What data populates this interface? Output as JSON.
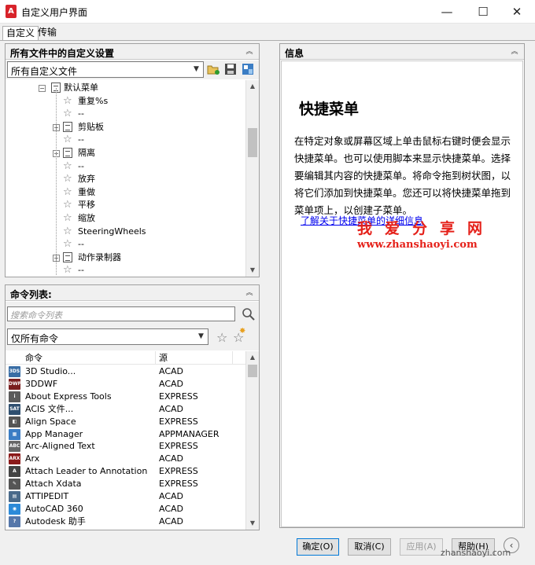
{
  "window": {
    "title": "自定义用户界面",
    "app_icon": "A",
    "minimize": "—",
    "maximize": "☐",
    "close": "✕"
  },
  "tabs": [
    "自定义",
    "传输"
  ],
  "custom_settings": {
    "header": "所有文件中的自定义设置",
    "combo_value": "所有自定义文件",
    "tree": [
      {
        "label": "默认菜单",
        "icon": "menu",
        "level": 0,
        "expander": "−"
      },
      {
        "label": "重复%s",
        "icon": "star",
        "level": 1
      },
      {
        "label": "--",
        "icon": "star",
        "level": 1
      },
      {
        "label": "剪贴板",
        "icon": "doc",
        "level": 1,
        "expander": "+"
      },
      {
        "label": "--",
        "icon": "star",
        "level": 1
      },
      {
        "label": "隔离",
        "icon": "doc",
        "level": 1,
        "expander": "+"
      },
      {
        "label": "--",
        "icon": "star",
        "level": 1
      },
      {
        "label": "放弃",
        "icon": "star",
        "level": 1
      },
      {
        "label": "重做",
        "icon": "star",
        "level": 1
      },
      {
        "label": "平移",
        "icon": "star",
        "level": 1
      },
      {
        "label": "缩放",
        "icon": "star",
        "level": 1
      },
      {
        "label": "SteeringWheels",
        "icon": "star",
        "level": 1
      },
      {
        "label": "--",
        "icon": "star",
        "level": 1
      },
      {
        "label": "动作录制器",
        "icon": "doc",
        "level": 1,
        "expander": "+"
      },
      {
        "label": "--",
        "icon": "star",
        "level": 1
      }
    ]
  },
  "command_list": {
    "header": "命令列表:",
    "search_placeholder": "搜索命令列表",
    "filter_value": "仅所有命令",
    "col_command": "命令",
    "col_source": "源",
    "rows": [
      {
        "name": "3D Studio...",
        "source": "ACAD",
        "color": "#3a6ea5",
        "glyph": "3DS"
      },
      {
        "name": "3DDWF",
        "source": "ACAD",
        "color": "#7a1e1e",
        "glyph": "DWF"
      },
      {
        "name": "About Express Tools",
        "source": "EXPRESS",
        "color": "#5a5a5a",
        "glyph": "i"
      },
      {
        "name": "ACIS 文件...",
        "source": "ACAD",
        "color": "#2f4f6f",
        "glyph": "SAT"
      },
      {
        "name": "Align Space",
        "source": "EXPRESS",
        "color": "#555",
        "glyph": "◧"
      },
      {
        "name": "App Manager",
        "source": "APPMANAGER",
        "color": "#3b7dc4",
        "glyph": "▦"
      },
      {
        "name": "Arc-Aligned Text",
        "source": "EXPRESS",
        "color": "#666",
        "glyph": "ABC"
      },
      {
        "name": "Arx",
        "source": "ACAD",
        "color": "#8b1a1a",
        "glyph": "ARX"
      },
      {
        "name": "Attach Leader to Annotation",
        "source": "EXPRESS",
        "color": "#444",
        "glyph": "A"
      },
      {
        "name": "Attach Xdata",
        "source": "EXPRESS",
        "color": "#555",
        "glyph": "✎"
      },
      {
        "name": "ATTIPEDIT",
        "source": "ACAD",
        "color": "#4a6a8a",
        "glyph": "▤"
      },
      {
        "name": "AutoCAD 360",
        "source": "ACAD",
        "color": "#2c8ad8",
        "glyph": "◉"
      },
      {
        "name": "Autodesk 助手",
        "source": "ACAD",
        "color": "#5577aa",
        "glyph": "?"
      }
    ]
  },
  "info": {
    "header": "信息",
    "title": "快捷菜单",
    "body": "在特定对象或屏幕区域上单击鼠标右键时便会显示快捷菜单。也可以使用脚本来显示快捷菜单。选择要编辑其内容的快捷菜单。将命令拖到树状图，以将它们添加到快捷菜单。您还可以将快捷菜单拖到菜单项上，以创建子菜单。",
    "link": "了解关于快捷菜单的详细信息",
    "watermark_cn": "我爱分享网",
    "watermark_url": "www.zhanshaoyi.com"
  },
  "footer": {
    "ok": "确定(O)",
    "cancel": "取消(C)",
    "apply": "应用(A)",
    "help": "帮助(H)",
    "watermark": "zhanshaoyi.com"
  }
}
